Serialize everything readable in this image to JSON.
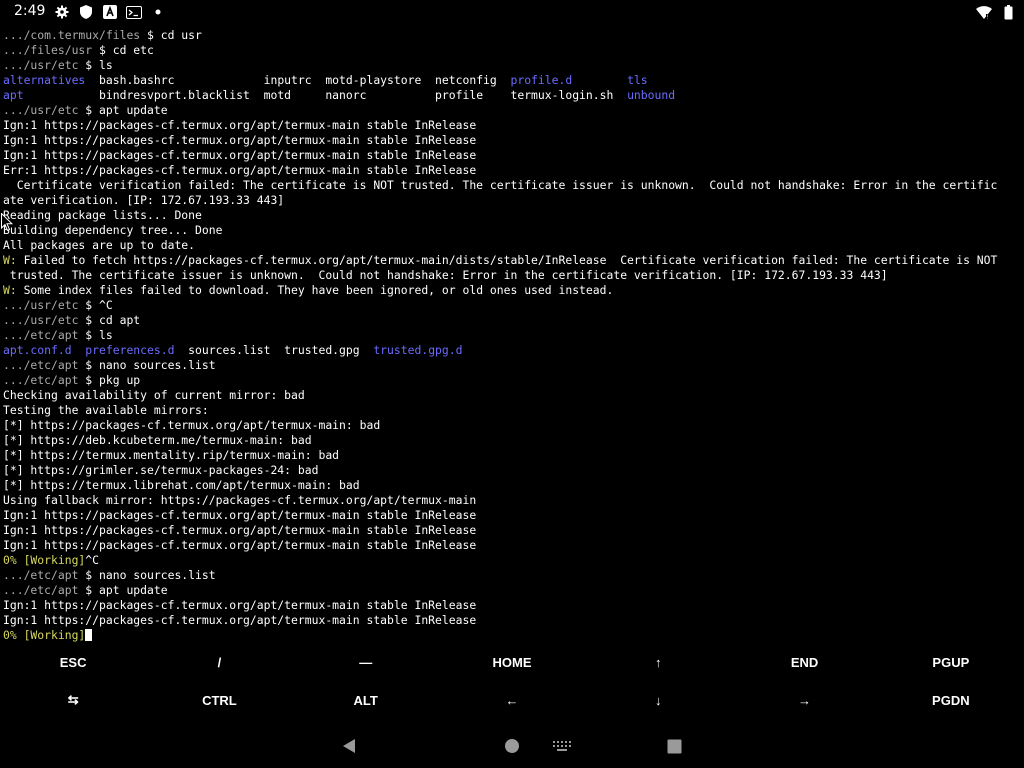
{
  "status_bar": {
    "time": "2:49",
    "icons_left": [
      "gear-icon",
      "shield-icon",
      "a-app-icon",
      "terminal-notification-icon",
      "dot-icon"
    ],
    "icons_right": [
      "wifi-icon",
      "battery-icon"
    ]
  },
  "colors": {
    "background": "#000000",
    "text": "#ffffff",
    "prompt_dim": "#aaaaaa",
    "directory_blue": "#6b6bff",
    "warning_yellow": "#d7d75f"
  },
  "terminal_lines": [
    [
      {
        "t": ".../com.termux/files ",
        "c": "dim"
      },
      {
        "t": "$ cd usr",
        "c": "default"
      }
    ],
    [
      {
        "t": ".../files/usr ",
        "c": "dim"
      },
      {
        "t": "$ cd etc",
        "c": "default"
      }
    ],
    [
      {
        "t": ".../usr/etc ",
        "c": "dim"
      },
      {
        "t": "$ ls",
        "c": "default"
      }
    ],
    [
      {
        "t": "alternatives",
        "c": "blue"
      },
      {
        "t": "  bash.bashrc             inputrc  motd-playstore  netconfig  ",
        "c": "default"
      },
      {
        "t": "profile.d",
        "c": "blue"
      },
      {
        "t": "        ",
        "c": "default"
      },
      {
        "t": "tls",
        "c": "blue"
      }
    ],
    [
      {
        "t": "apt",
        "c": "blue"
      },
      {
        "t": "           bindresvport.blacklist  motd     nanorc          profile    termux-login.sh  ",
        "c": "default"
      },
      {
        "t": "unbound",
        "c": "blue"
      }
    ],
    [
      {
        "t": ".../usr/etc ",
        "c": "dim"
      },
      {
        "t": "$ apt update",
        "c": "default"
      }
    ],
    [
      {
        "t": "Ign:1 https://packages-cf.termux.org/apt/termux-main stable InRelease",
        "c": "default"
      }
    ],
    [
      {
        "t": "Ign:1 https://packages-cf.termux.org/apt/termux-main stable InRelease",
        "c": "default"
      }
    ],
    [
      {
        "t": "Ign:1 https://packages-cf.termux.org/apt/termux-main stable InRelease",
        "c": "default"
      }
    ],
    [
      {
        "t": "Err:1 https://packages-cf.termux.org/apt/termux-main stable InRelease",
        "c": "default"
      }
    ],
    [
      {
        "t": "  Certificate verification failed: The certificate is NOT trusted. The certificate issuer is unknown.  Could not handshake: Error in the certific",
        "c": "default"
      }
    ],
    [
      {
        "t": "ate verification. [IP: 172.67.193.33 443]",
        "c": "default"
      }
    ],
    [
      {
        "t": "Reading package lists... Done",
        "c": "default"
      }
    ],
    [
      {
        "t": "Building dependency tree... Done",
        "c": "default"
      }
    ],
    [
      {
        "t": "All packages are up to date.",
        "c": "default"
      }
    ],
    [
      {
        "t": "W:",
        "c": "yellow"
      },
      {
        "t": " Failed to fetch https://packages-cf.termux.org/apt/termux-main/dists/stable/InRelease  Certificate verification failed: The certificate is NOT",
        "c": "default"
      }
    ],
    [
      {
        "t": " trusted. The certificate issuer is unknown.  Could not handshake: Error in the certificate verification. [IP: 172.67.193.33 443]",
        "c": "default"
      }
    ],
    [
      {
        "t": "W:",
        "c": "yellow"
      },
      {
        "t": " Some index files failed to download. They have been ignored, or old ones used instead.",
        "c": "default"
      }
    ],
    [
      {
        "t": ".../usr/etc ",
        "c": "dim"
      },
      {
        "t": "$ ^C",
        "c": "default"
      }
    ],
    [
      {
        "t": ".../usr/etc ",
        "c": "dim"
      },
      {
        "t": "$ cd apt",
        "c": "default"
      }
    ],
    [
      {
        "t": ".../etc/apt ",
        "c": "dim"
      },
      {
        "t": "$ ls",
        "c": "default"
      }
    ],
    [
      {
        "t": "apt.conf.d",
        "c": "blue"
      },
      {
        "t": "  ",
        "c": "default"
      },
      {
        "t": "preferences.d",
        "c": "blue"
      },
      {
        "t": "  sources.list  trusted.gpg  ",
        "c": "default"
      },
      {
        "t": "trusted.gpg.d",
        "c": "blue"
      }
    ],
    [
      {
        "t": ".../etc/apt ",
        "c": "dim"
      },
      {
        "t": "$ nano sources.list",
        "c": "default"
      }
    ],
    [
      {
        "t": ".../etc/apt ",
        "c": "dim"
      },
      {
        "t": "$ pkg up",
        "c": "default"
      }
    ],
    [
      {
        "t": "Checking availability of current mirror: bad",
        "c": "default"
      }
    ],
    [
      {
        "t": "Testing the available mirrors:",
        "c": "default"
      }
    ],
    [
      {
        "t": "[*] https://packages-cf.termux.org/apt/termux-main: bad",
        "c": "default"
      }
    ],
    [
      {
        "t": "[*] https://deb.kcubeterm.me/termux-main: bad",
        "c": "default"
      }
    ],
    [
      {
        "t": "[*] https://termux.mentality.rip/termux-main: bad",
        "c": "default"
      }
    ],
    [
      {
        "t": "[*] https://grimler.se/termux-packages-24: bad",
        "c": "default"
      }
    ],
    [
      {
        "t": "[*] https://termux.librehat.com/apt/termux-main: bad",
        "c": "default"
      }
    ],
    [
      {
        "t": "Using fallback mirror: https://packages-cf.termux.org/apt/termux-main",
        "c": "default"
      }
    ],
    [
      {
        "t": "Ign:1 https://packages-cf.termux.org/apt/termux-main stable InRelease",
        "c": "default"
      }
    ],
    [
      {
        "t": "Ign:1 https://packages-cf.termux.org/apt/termux-main stable InRelease",
        "c": "default"
      }
    ],
    [
      {
        "t": "Ign:1 https://packages-cf.termux.org/apt/termux-main stable InRelease",
        "c": "default"
      }
    ],
    [
      {
        "t": "0% [Working]",
        "c": "yellow"
      },
      {
        "t": "^C",
        "c": "default"
      }
    ],
    [
      {
        "t": ".../etc/apt ",
        "c": "dim"
      },
      {
        "t": "$ nano sources.list",
        "c": "default"
      }
    ],
    [
      {
        "t": ".../etc/apt ",
        "c": "dim"
      },
      {
        "t": "$ apt update",
        "c": "default"
      }
    ],
    [
      {
        "t": "Ign:1 https://packages-cf.termux.org/apt/termux-main stable InRelease",
        "c": "default"
      }
    ],
    [
      {
        "t": "Ign:1 https://packages-cf.termux.org/apt/termux-main stable InRelease",
        "c": "default"
      }
    ],
    [
      {
        "t": "0% [Working]",
        "c": "yellow"
      }
    ]
  ],
  "extra_keys": {
    "row1": [
      "ESC",
      "/",
      "—",
      "HOME",
      "↑",
      "END",
      "PGUP"
    ],
    "row2": [
      "⇆",
      "CTRL",
      "ALT",
      "←",
      "↓",
      "→",
      "PGDN"
    ]
  },
  "nav_bar": {
    "buttons": [
      "back-icon",
      "home-icon",
      "keyboard-icon",
      "recents-icon"
    ]
  }
}
